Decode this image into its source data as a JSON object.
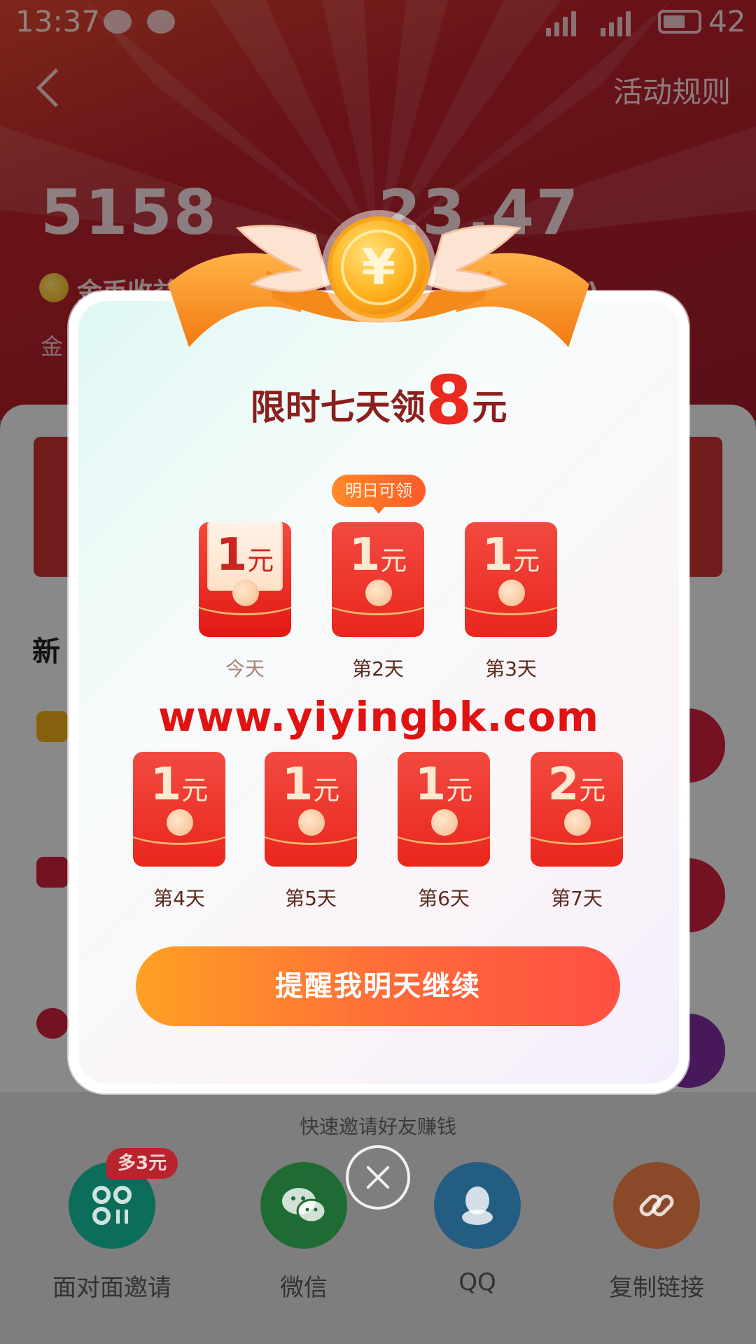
{
  "status_bar": {
    "time": "13:37",
    "battery": "42"
  },
  "header": {
    "rules_label": "活动规则",
    "coin_value": "5158",
    "cash_value": "23.47",
    "coin_label": "金币收益",
    "cash_label_suffix": "(张)",
    "sub_text": "金"
  },
  "background": {
    "section_title": "新"
  },
  "modal": {
    "title_prefix": "限时七天领",
    "title_amount": "8",
    "title_suffix": "元",
    "tip": "明日可领",
    "unit": "元",
    "days": [
      {
        "label": "今天",
        "amount": "1",
        "state": "opened"
      },
      {
        "label": "第2天",
        "amount": "1",
        "state": "closed"
      },
      {
        "label": "第3天",
        "amount": "1",
        "state": "closed"
      },
      {
        "label": "第4天",
        "amount": "1",
        "state": "closed"
      },
      {
        "label": "第5天",
        "amount": "1",
        "state": "closed"
      },
      {
        "label": "第6天",
        "amount": "1",
        "state": "closed"
      },
      {
        "label": "第7天",
        "amount": "2",
        "state": "closed"
      }
    ],
    "watermark": "www.yiyingbk.com",
    "cta_label": "提醒我明天继续",
    "coin_symbol": "¥"
  },
  "share": {
    "title": "快速邀请好友赚钱",
    "badge": "多3元",
    "items": [
      {
        "label": "面对面邀请",
        "icon": "grid-icon",
        "color": "#0d6d5c"
      },
      {
        "label": "微信",
        "icon": "wechat-icon",
        "color": "#1e6c33"
      },
      {
        "label": "QQ",
        "icon": "qq-icon",
        "color": "#245d82"
      },
      {
        "label": "复制链接",
        "icon": "link-icon",
        "color": "#8a4a2a"
      }
    ]
  }
}
